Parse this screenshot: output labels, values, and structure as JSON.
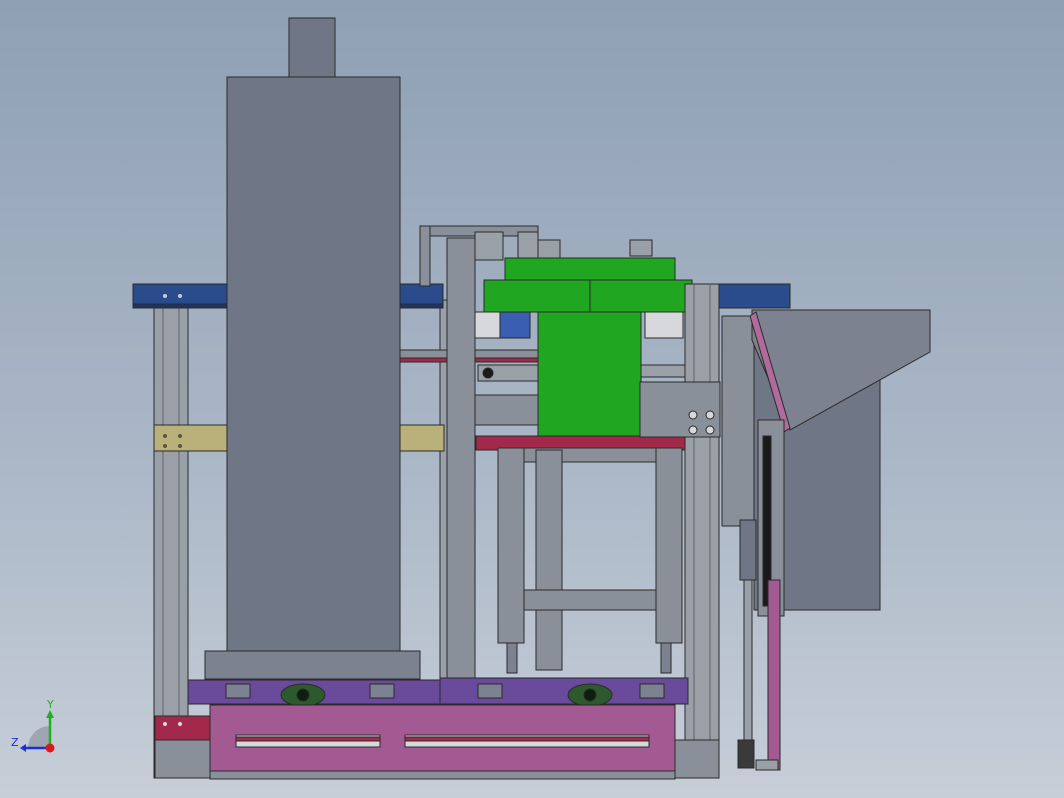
{
  "view": {
    "background_top": "#8fa0b4",
    "background_bottom": "#c7ced8"
  },
  "triad": {
    "y_label": "Y",
    "z_label": "Z",
    "y_color": "#1db21d",
    "z_color": "#1a2fd6",
    "x_color": "#d81b1b"
  },
  "colors": {
    "housing_gray": "#6f7686",
    "frame_gray": "#8a909a",
    "blue_beam": "#2a4b8c",
    "yellow_beam": "#b9b07a",
    "green_part": "#21a621",
    "magenta_base": "#a35a92",
    "purple_plate": "#6a4a9a",
    "red_accent": "#a3294a",
    "black": "#1a1a1a"
  }
}
